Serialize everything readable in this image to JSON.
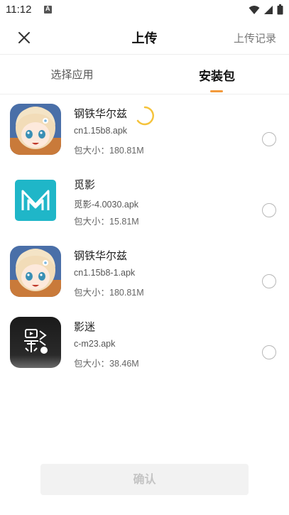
{
  "status_bar": {
    "time": "11:12",
    "icons": [
      "notification-a-icon",
      "wifi-icon",
      "signal-icon",
      "battery-icon"
    ]
  },
  "header": {
    "title": "上传",
    "right_link": "上传记录",
    "close_icon": "close-icon"
  },
  "tabs": [
    {
      "label": "选择应用",
      "active": false
    },
    {
      "label": "安装包",
      "active": true
    }
  ],
  "apps": [
    {
      "name": "钢铁华尔兹",
      "file": "cn1.15b8.apk",
      "size_label": "包大小：",
      "size": "180.81M",
      "icon": "anime-girl-icon",
      "loading": true,
      "selected": false
    },
    {
      "name": "觅影",
      "file": "觅影-4.0030.apk",
      "size_label": "包大小：",
      "size": "15.81M",
      "icon": "m-logo-icon",
      "loading": false,
      "selected": false
    },
    {
      "name": "钢铁华尔兹",
      "file": "cn1.15b8-1.apk",
      "size_label": "包大小：",
      "size": "180.81M",
      "icon": "anime-girl-icon",
      "loading": false,
      "selected": false
    },
    {
      "name": "影迷",
      "file": "c-m23.apk",
      "size_label": "包大小：",
      "size": "38.46M",
      "icon": "yingmi-logo-icon",
      "loading": false,
      "selected": false
    }
  ],
  "confirm_button": "确认",
  "colors": {
    "accent": "#f39a3c",
    "spinner": "#f5c33b",
    "muted_button_bg": "#f2f2f2",
    "muted_button_text": "#c4c4c4",
    "m_logo_bg": "#1fb6c8"
  }
}
